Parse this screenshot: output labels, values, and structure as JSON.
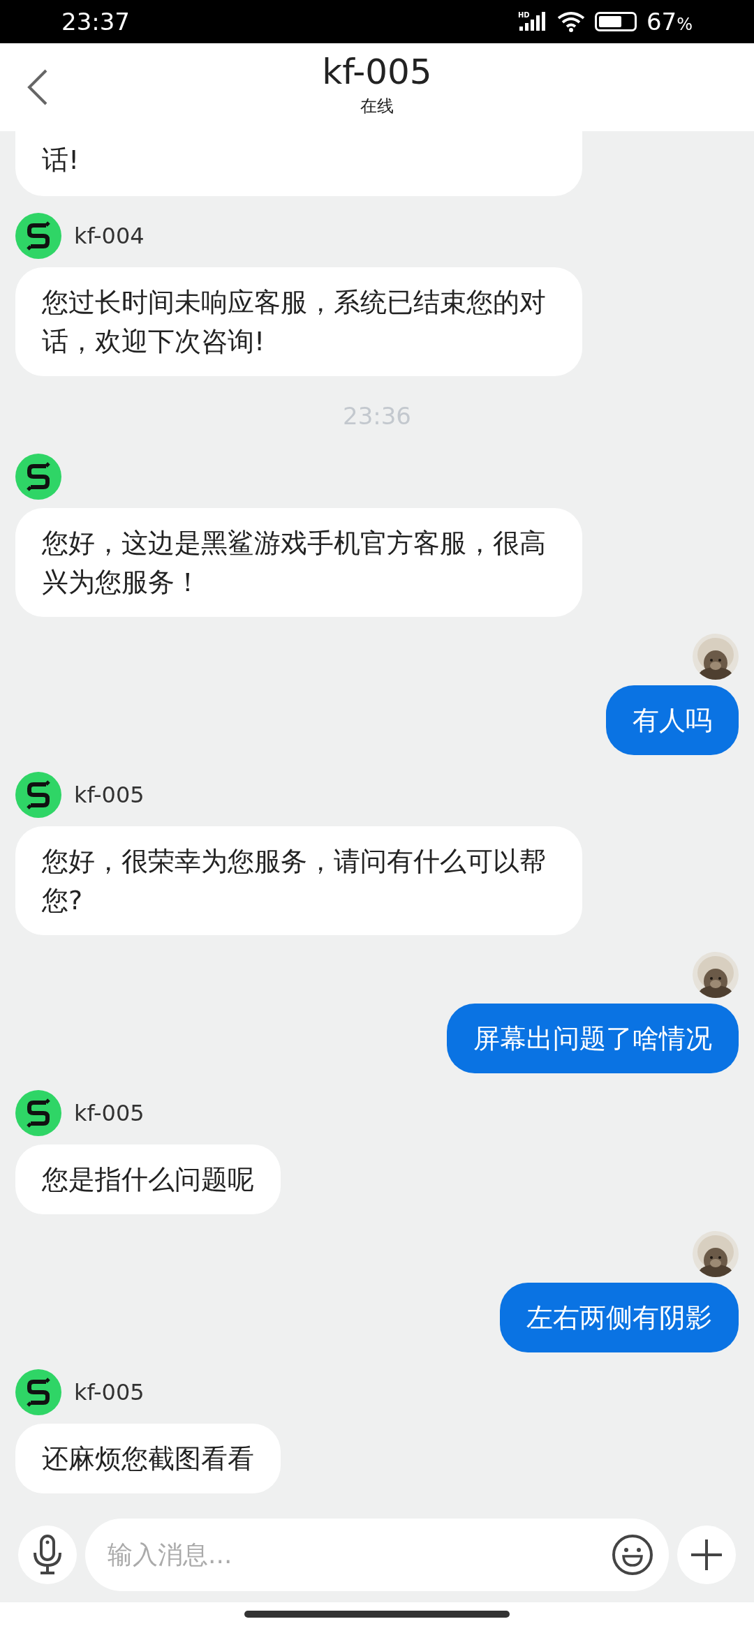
{
  "status_bar": {
    "time": "23:37",
    "network": "HD",
    "battery": "67",
    "battery_unit": "%"
  },
  "header": {
    "title": "kf-005",
    "subtitle": "在线"
  },
  "messages": [
    {
      "kind": "agent",
      "cut": true,
      "text": "话!"
    },
    {
      "kind": "agent",
      "name": "kf-004",
      "text": "您过长时间未响应客服，系统已结束您的对话，欢迎下次咨询!"
    },
    {
      "kind": "time",
      "text": "23:36"
    },
    {
      "kind": "agent",
      "text": "您好，这边是黑鲨游戏手机官方客服，很高兴为您服务！"
    },
    {
      "kind": "user",
      "text": "有人吗"
    },
    {
      "kind": "agent",
      "name": "kf-005",
      "text": "您好，很荣幸为您服务，请问有什么可以帮您?"
    },
    {
      "kind": "user",
      "text": "屏幕出问题了啥情况"
    },
    {
      "kind": "agent",
      "name": "kf-005",
      "text": "您是指什么问题呢"
    },
    {
      "kind": "user",
      "text": "左右两侧有阴影"
    },
    {
      "kind": "agent",
      "name": "kf-005",
      "text": "还麻烦您截图看看"
    }
  ],
  "input": {
    "placeholder": "输入消息..."
  }
}
